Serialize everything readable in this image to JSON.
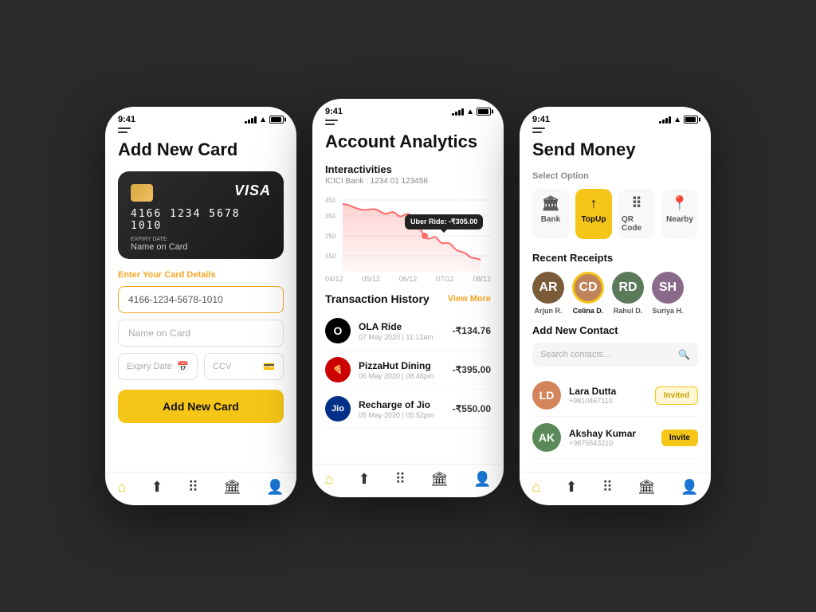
{
  "background": "#2a2a2a",
  "phone1": {
    "status_time": "9:41",
    "title": "Add New Card",
    "card": {
      "number": "4166 1234 5678 1010",
      "brand": "VISA",
      "expiry_label": "Expiry Date",
      "name": "Name on Card"
    },
    "section_label": "Enter Your Card Details",
    "card_number_input": "4166-1234-5678-1010",
    "name_placeholder": "Name on Card",
    "expiry_placeholder": "Expiry Date",
    "ccv_placeholder": "CCV",
    "add_btn": "Add New Card",
    "nav": [
      "🏠",
      "📤",
      "⠿",
      "🏦",
      "👤"
    ]
  },
  "phone2": {
    "status_time": "9:41",
    "title": "Account Analytics",
    "chart": {
      "title": "Interactivities",
      "subtitle": "ICICI Bank : 1234 01 123456",
      "y_labels": [
        "450",
        "350",
        "250",
        "150"
      ],
      "x_labels": [
        "04/12",
        "05/12",
        "06/12",
        "07/12",
        "08/12"
      ],
      "tooltip": "Uber Ride: -₹305.00"
    },
    "transactions_title": "Transaction History",
    "view_more": "View More",
    "transactions": [
      {
        "logo": "OLA",
        "name": "OLA Ride",
        "date": "07 May 2020 | 11:12am",
        "amount": "-₹134.76",
        "color": "#000"
      },
      {
        "logo": "🍕",
        "name": "PizzaHut Dining",
        "date": "06 May 2020 | 08:48pm",
        "amount": "-₹395.00",
        "color": "#cc0000"
      },
      {
        "logo": "Jio",
        "name": "Recharge of Jio",
        "date": "05 May 2020 | 05:52pm",
        "amount": "-₹550.00",
        "color": "#003087"
      }
    ],
    "nav": [
      "🏠",
      "📤",
      "⠿",
      "🏦",
      "👤"
    ]
  },
  "phone3": {
    "status_time": "9:41",
    "title": "Send Money",
    "select_option_label": "Select Option",
    "options": [
      {
        "icon": "🏦",
        "label": "Bank",
        "active": false
      },
      {
        "icon": "↑",
        "label": "TopUp",
        "active": true
      },
      {
        "icon": "⠿",
        "label": "QR Code",
        "active": false
      },
      {
        "icon": "📍",
        "label": "Nearby",
        "active": false
      }
    ],
    "recent_title": "Recent Receipts",
    "recent_contacts": [
      {
        "name": "Arjun R.",
        "initials": "AR",
        "color": "#7a5c3a"
      },
      {
        "name": "Celina D.",
        "initials": "CD",
        "color": "#c0845a"
      },
      {
        "name": "Rahul D.",
        "initials": "RD",
        "color": "#5a7a5a"
      },
      {
        "name": "Suriya H.",
        "initials": "SH",
        "color": "#8a6a8a"
      }
    ],
    "contacts_title": "Add New Contact",
    "search_placeholder": "Search contacts...",
    "contacts": [
      {
        "name": "Lara Dutta",
        "phone": "+9810467110",
        "status": "Invited",
        "color": "#d4845a"
      },
      {
        "name": "Akshay Kumar",
        "phone": "+9876543210",
        "status": "Invite",
        "color": "#5a8a5a"
      }
    ],
    "nav": [
      "🏠",
      "📤",
      "⠿",
      "🏦",
      "👤"
    ]
  }
}
